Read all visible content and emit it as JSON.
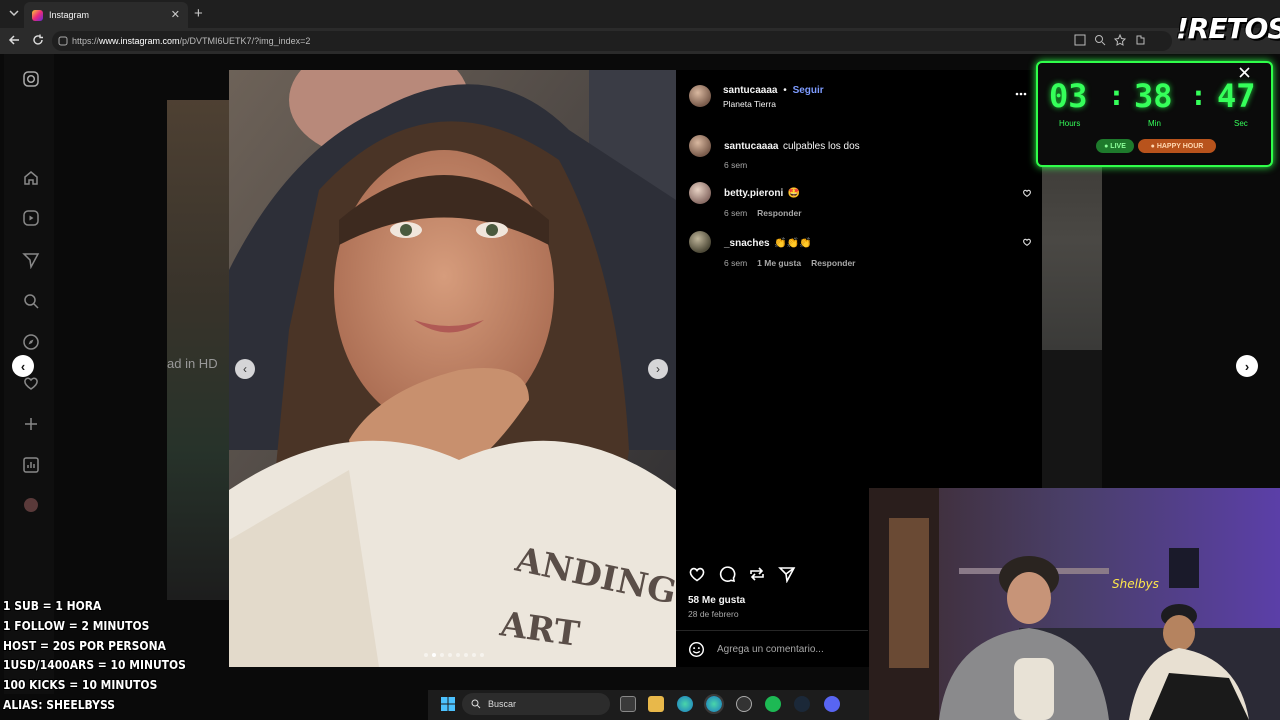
{
  "browser": {
    "tab_title": "Instagram",
    "url_prefix": "https://",
    "url_host": "www.instagram.com",
    "url_path": "/p/DVTMI6UETK7/?img_index=2"
  },
  "post": {
    "author": "santucaaaa",
    "separator": "•",
    "follow_label": "Seguir",
    "location": "Planeta Tierra",
    "likes": "58 Me gusta",
    "date": "28 de febrero",
    "comment_placeholder": "Agrega un comentario...",
    "comments": [
      {
        "user": "santucaaaa",
        "text": "culpables los dos",
        "time": "6 sem",
        "likes": "",
        "reply": ""
      },
      {
        "user": "betty.pieroni",
        "text": "🤩",
        "time": "6 sem",
        "likes": "",
        "reply": "Responder"
      },
      {
        "user": "_snaches",
        "text": "👏👏👏",
        "time": "6 sem",
        "likes": "1 Me gusta",
        "reply": "Responder"
      }
    ],
    "background_post_text": "ad in HD"
  },
  "timer": {
    "hours": "03",
    "minutes": "38",
    "seconds": "47",
    "hours_label": "Hours",
    "minutes_label": "Min",
    "seconds_label": "Sec",
    "live_label": "● LIVE",
    "happy_hour_label": "● HAPPY HOUR",
    "color": "#35ff5a"
  },
  "overlay": {
    "brand": "!RETOS",
    "rules": [
      "1 SUB = 1 HORA",
      "1 FOLLOW = 2 MINUTOS",
      "HOST = 20S POR PERSONA",
      "1USD/1400ARS = 10 MINUTOS",
      "100 KICKS = 10 MINUTOS",
      "ALIAS: SHEELBYSS"
    ],
    "webcam_neon_sign": "Shelbys"
  },
  "taskbar": {
    "search_label": "Buscar"
  },
  "colors": {
    "accent": "#0095f6",
    "link": "#7e9cff"
  }
}
